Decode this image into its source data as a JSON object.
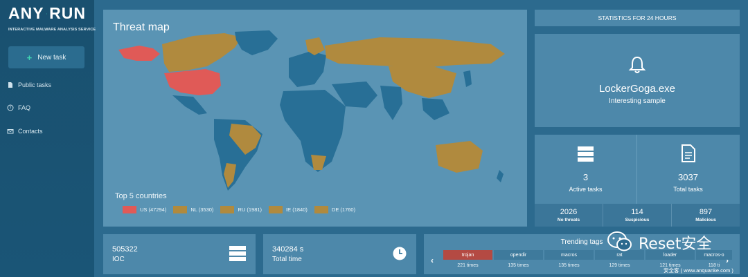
{
  "brand": {
    "logo_left": "ANY",
    "logo_right": "RUN",
    "tagline": "INTERACTIVE MALWARE ANALYSIS SERVICE"
  },
  "sidebar": {
    "new_task_label": "New task",
    "items": [
      {
        "label": "Public tasks",
        "icon": "document-icon"
      },
      {
        "label": "FAQ",
        "icon": "question-circle-icon"
      },
      {
        "label": "Contacts",
        "icon": "envelope-icon"
      }
    ]
  },
  "threat_map": {
    "title": "Threat map",
    "top5_title": "Top 5 countries",
    "legend": [
      {
        "label": "US (47294)",
        "color": "#e05a57"
      },
      {
        "label": "NL (3530)",
        "color": "#b08a3e"
      },
      {
        "label": "RU (1981)",
        "color": "#b08a3e"
      },
      {
        "label": "IE (1840)",
        "color": "#b08a3e"
      },
      {
        "label": "DE (1760)",
        "color": "#b08a3e"
      }
    ]
  },
  "stats": {
    "header": "STATISTICS FOR 24 HOURS",
    "sample_name": "LockerGoga.exe",
    "sample_label": "Interesting sample",
    "active_tasks": "3",
    "active_tasks_label": "Active tasks",
    "total_tasks": "3037",
    "total_tasks_label": "Total tasks",
    "breakdown": [
      {
        "value": "2026",
        "label": "No threats"
      },
      {
        "value": "114",
        "label": "Suspicious"
      },
      {
        "value": "897",
        "label": "Malicious"
      }
    ]
  },
  "ioc": {
    "value": "505322",
    "label": "IOC"
  },
  "total_time": {
    "value": "340284 s",
    "label": "Total time"
  },
  "trending": {
    "title": "Trending tags",
    "tags": [
      {
        "name": "trojan",
        "times": "221 times"
      },
      {
        "name": "opendir",
        "times": "135 times"
      },
      {
        "name": "macros",
        "times": "135 times"
      },
      {
        "name": "rat",
        "times": "129 times"
      },
      {
        "name": "loader",
        "times": "121 times"
      },
      {
        "name": "macros-o",
        "times": "118 ti"
      }
    ]
  },
  "watermark": {
    "text": "Reset安全",
    "sub": "安全客 ( www.anquanke.com )"
  },
  "colors": {
    "accent": "#3fd3b2",
    "active_tag": "#b44a43",
    "land": "#286f96",
    "highlight": "#b08a3e",
    "top": "#e05a57"
  }
}
